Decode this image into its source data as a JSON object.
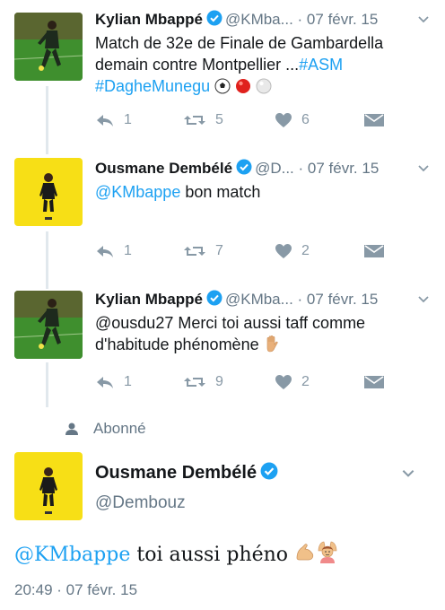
{
  "tweets": [
    {
      "name": "Kylian Mbappé",
      "handle": "@KMba...",
      "date": "· 07 févr. 15",
      "text_lines": [
        "Match de 32e de Finale de Gambardella",
        "demain contre Montpellier ..."
      ],
      "hashtag_inline": "#ASM",
      "hashtag_line": "#DagheMunegu",
      "replies": "1",
      "retweets": "5",
      "likes": "6"
    },
    {
      "name": "Ousmane Dembélé",
      "handle": "@D...",
      "date": "· 07 févr. 15",
      "mention": "@KMbappe",
      "text": " bon match",
      "replies": "1",
      "retweets": "7",
      "likes": "2"
    },
    {
      "name": "Kylian Mbappé",
      "handle": "@KMba...",
      "date": "· 07 févr. 15",
      "text_lines": [
        "@ousdu27 Merci toi aussi taff comme",
        "d'habitude phénomène"
      ],
      "replies": "1",
      "retweets": "9",
      "likes": "2"
    }
  ],
  "follow_label": "Abonné",
  "main_tweet": {
    "name": "Ousmane Dembélé",
    "handle": "@Dembouz",
    "mention": "@KMbappe",
    "text": " toi aussi phéno",
    "timestamp": "20:49 · 07 févr. 15"
  },
  "colors": {
    "link": "#1da1f2",
    "secondary_text": "#657786",
    "action_icon": "#8899a6",
    "verified": "#1da1f2",
    "avatar_yellow": "#f7df16"
  },
  "icons": [
    "verified-badge-icon",
    "chevron-down-icon",
    "reply-icon",
    "retweet-icon",
    "heart-icon",
    "direct-message-icon",
    "person-icon",
    "soccer-ball-emoji",
    "red-ball-emoji",
    "white-ball-emoji",
    "raised-hand-emoji",
    "flexed-biceps-emoji",
    "person-gesturing-ok-emoji"
  ]
}
